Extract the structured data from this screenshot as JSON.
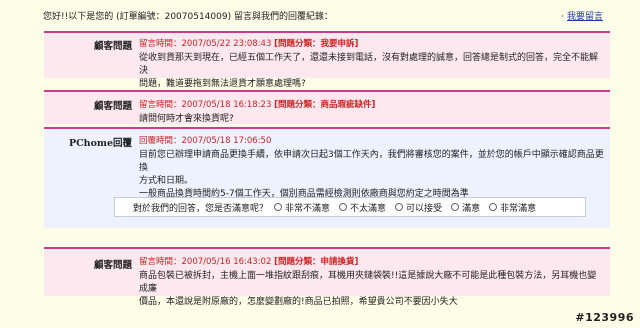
{
  "header": {
    "intro": "您好!!以下是您的 (訂單編號：20070514009",
    "intro_tail": ") 留言與我們的回覆紀錄：",
    "reply_dot": "·",
    "reply_link": "我要留言"
  },
  "entries": [
    {
      "label": "顧客問題",
      "meta_time": "留言時間：2007/05/22 23:08:43",
      "meta_cat": "[問題分類：我要申訴]",
      "lines": [
        "從收到貨那天到現在，已經五個工作天了，還還未接到電話，沒有對處理的誠意，回答總是制式的回答，完全不能解決",
        "問題，難道要拖到無法退貨才願意處理嗎?"
      ]
    },
    {
      "label": "顧客問題",
      "meta_time": "留言時間：2007/05/18 16:18:23",
      "meta_cat": "[問題分類：商品瑕疵缺件]",
      "lines": [
        "請問何時才會來換貨呢?"
      ]
    },
    {
      "label": "PChome回覆",
      "meta_time": "回覆時間：2007/05/18 17:06:50",
      "meta_cat": "",
      "lines": [
        "目前您已辦理申請商品更換手續，依申請次日起3個工作天內，我們將審核您的案件，並於您的帳戶中顯示確認商品更換",
        "方式和日期。",
        "一般商品換貨時間約5-7個工作天，個別商品需經檢測則依廠商與您約定之時間為準"
      ],
      "survey": {
        "question": "對於我們的回答，您是否滿意呢？",
        "options": [
          "非常不滿意",
          "不太滿意",
          "可以接受",
          "滿意",
          "非常滿意"
        ]
      }
    },
    {
      "label": "顧客問題",
      "meta_time": "留言時間：2007/05/16 16:43:02",
      "meta_cat": "[問題分類：申請換貨]",
      "lines": [
        "商品包裝已被拆封，主機上面一堆指紋跟刮痕，耳機用夾鏈袋裝!!這是據說大廠不可能是此種包裝方法，另耳機也變成廉",
        "價品，本還說是附原廠的，怎麼變劃廠的!商品已拍照，希望貴公司不要因小失大"
      ]
    }
  ],
  "watermark": "#123996"
}
